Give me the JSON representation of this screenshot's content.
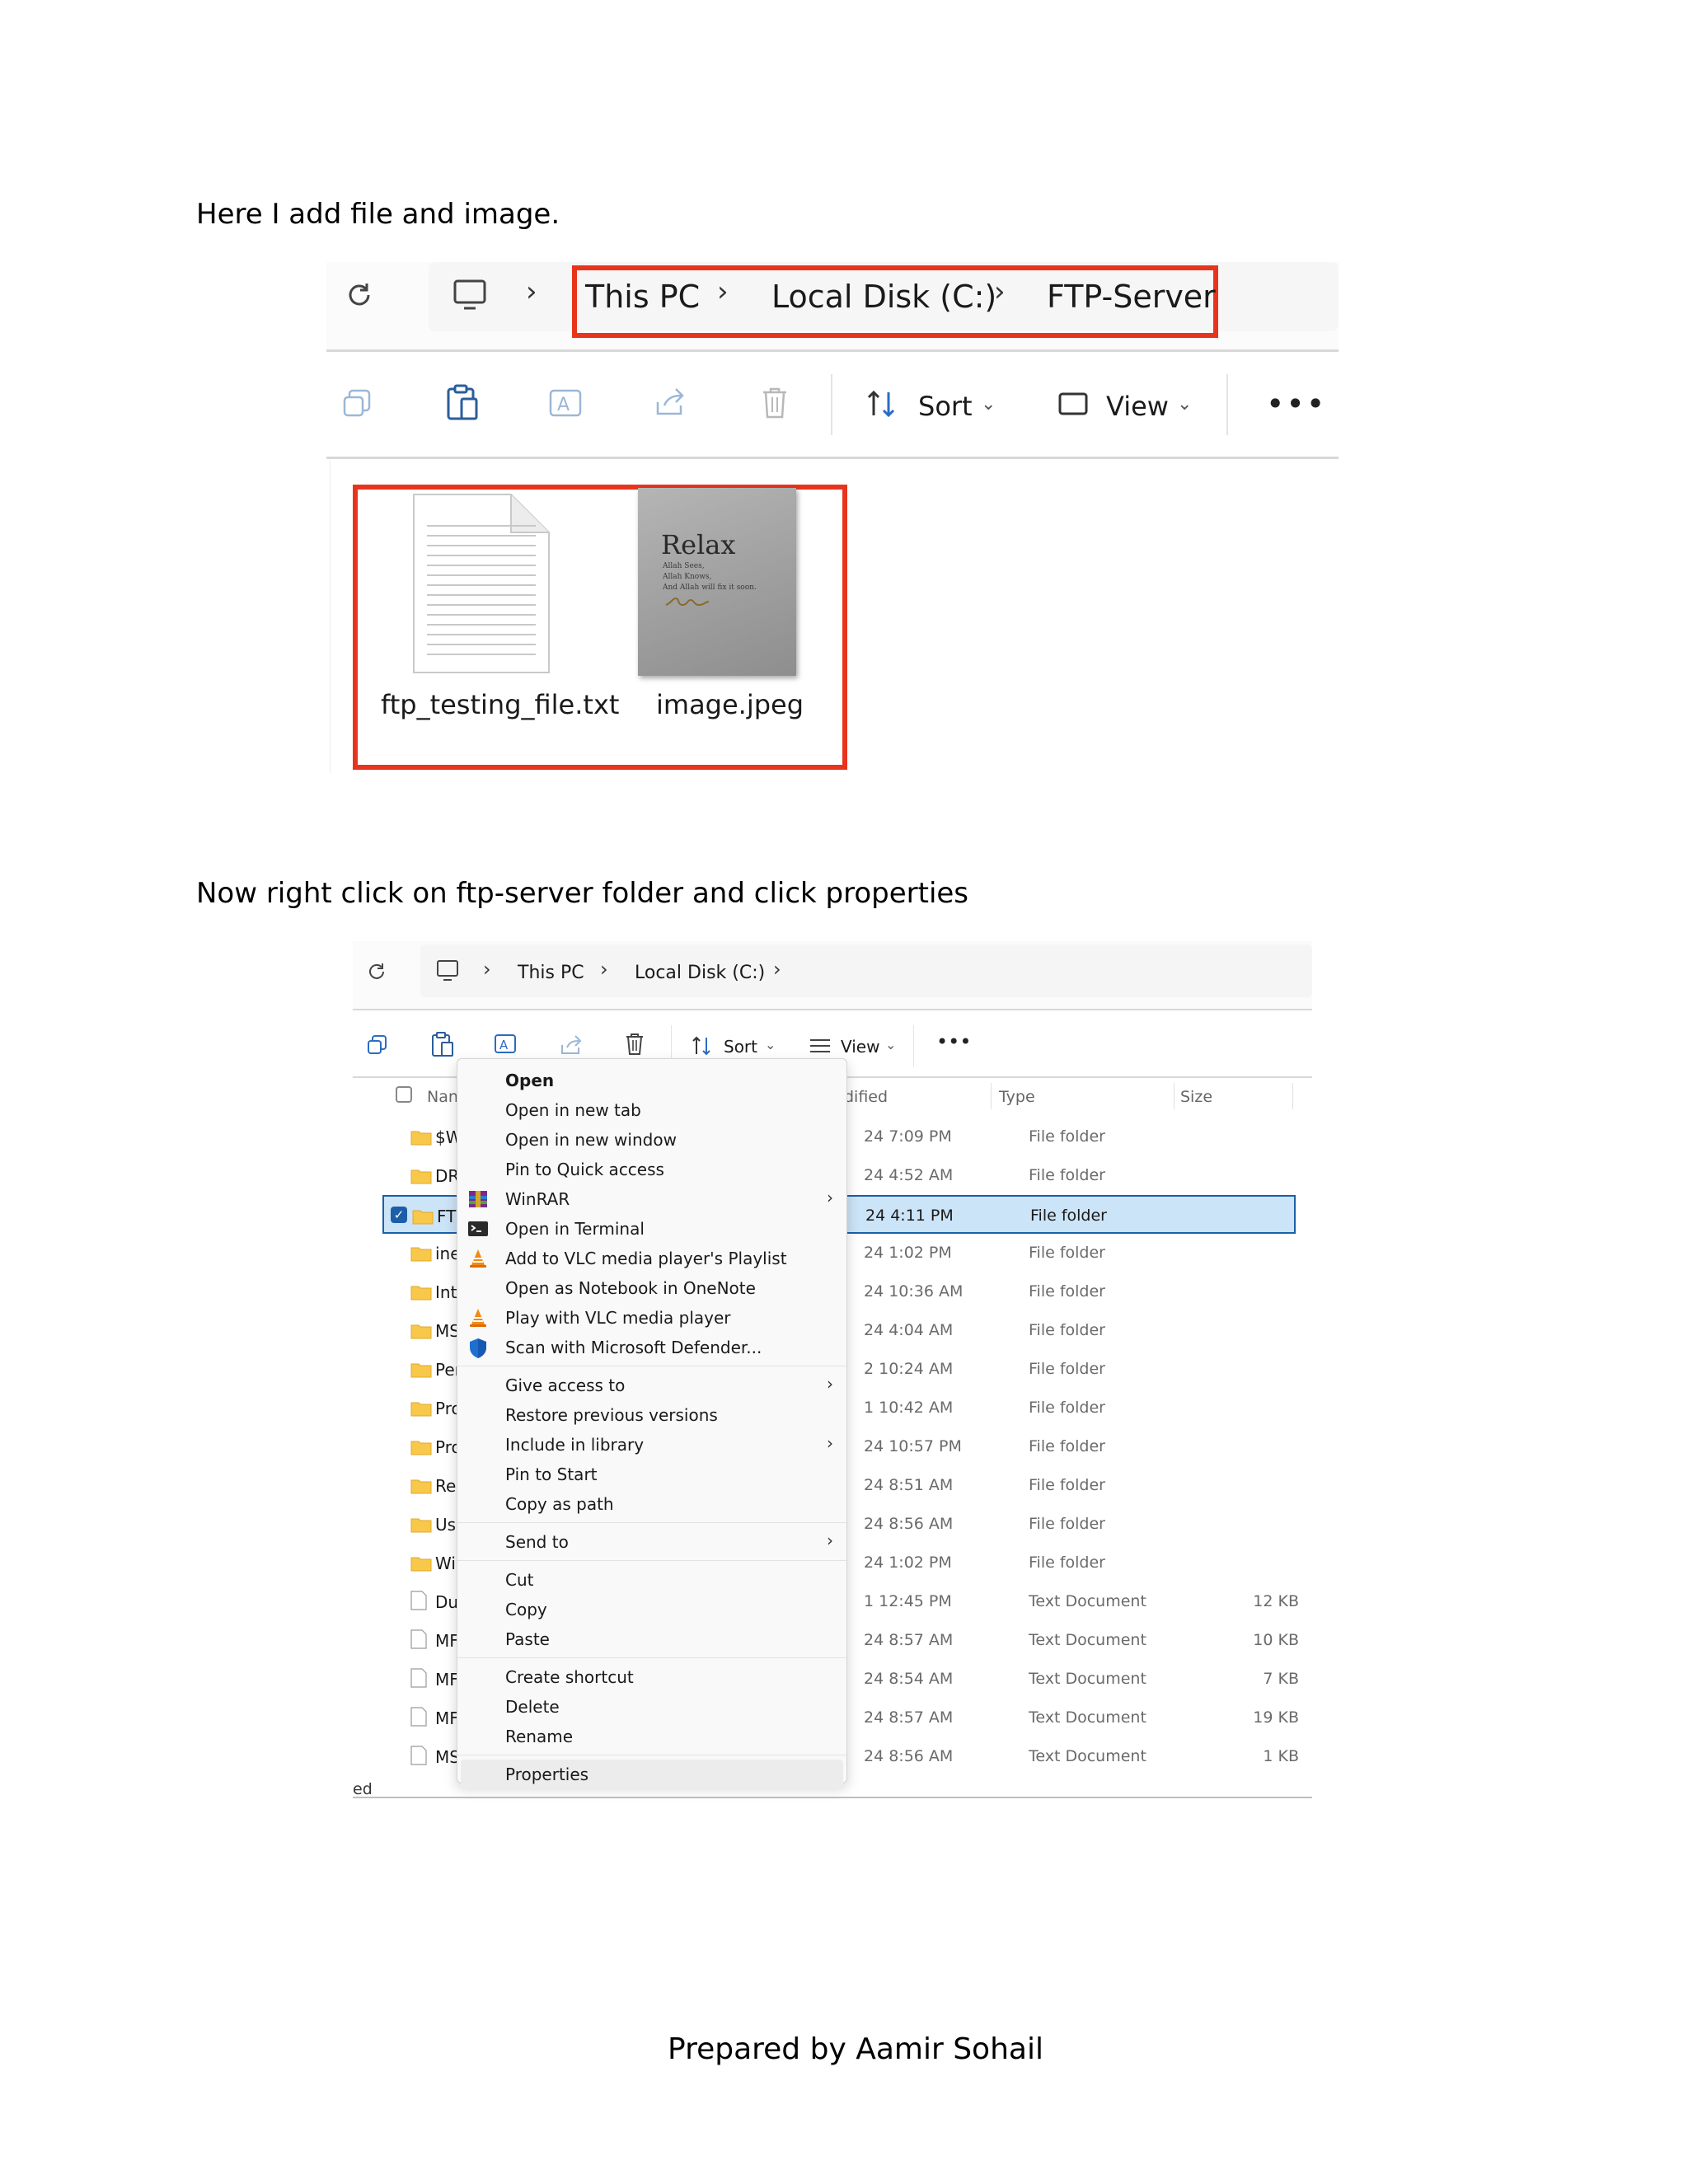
{
  "doc": {
    "caption1": "Here I add file and image.",
    "caption2": "Now right click on ftp-server folder and click properties",
    "footer": "Prepared by Aamir Sohail"
  },
  "shot1": {
    "breadcrumb": [
      "This PC",
      "Local Disk (C:)",
      "FTP-Server"
    ],
    "toolbar": {
      "sort_label": "Sort",
      "view_label": "View"
    },
    "files": [
      {
        "name": "ftp_testing_file.txt",
        "kind": "text-file"
      },
      {
        "name": "image.jpeg",
        "kind": "image",
        "thumb_title": "Relax",
        "thumb_lines": [
          "Allah Sees,",
          "Allah Knows,",
          "And Allah will fix it soon."
        ]
      }
    ],
    "highlight_color": "#e8341c"
  },
  "shot2": {
    "breadcrumb": [
      "This PC",
      "Local Disk (C:)"
    ],
    "toolbar": {
      "sort_label": "Sort",
      "view_label": "View"
    },
    "headers": {
      "name": "Nan",
      "date": "dified",
      "type": "Type",
      "size": "Size"
    },
    "rows": [
      {
        "name": "$W",
        "date": "24 7:09 PM",
        "type": "File folder",
        "size": "",
        "icon": "folder-icon"
      },
      {
        "name": "DR",
        "date": "24 4:52 AM",
        "type": "File folder",
        "size": "",
        "icon": "folder-icon"
      },
      {
        "name": "FTP",
        "date": "24 4:11 PM",
        "type": "File folder",
        "size": "",
        "icon": "folder-icon",
        "selected": true
      },
      {
        "name": "ine",
        "date": "24 1:02 PM",
        "type": "File folder",
        "size": "",
        "icon": "folder-icon"
      },
      {
        "name": "Inte",
        "date": "24 10:36 AM",
        "type": "File folder",
        "size": "",
        "icon": "folder-icon"
      },
      {
        "name": "MS",
        "date": "24 4:04 AM",
        "type": "File folder",
        "size": "",
        "icon": "folder-icon"
      },
      {
        "name": "Per",
        "date": "2 10:24 AM",
        "type": "File folder",
        "size": "",
        "icon": "folder-icon"
      },
      {
        "name": "Pro",
        "date": "1 10:42 AM",
        "type": "File folder",
        "size": "",
        "icon": "folder-icon"
      },
      {
        "name": "Pro",
        "date": "24 10:57 PM",
        "type": "File folder",
        "size": "",
        "icon": "folder-icon"
      },
      {
        "name": "Rec",
        "date": "24 8:51 AM",
        "type": "File folder",
        "size": "",
        "icon": "folder-icon"
      },
      {
        "name": "Use",
        "date": "24 8:56 AM",
        "type": "File folder",
        "size": "",
        "icon": "folder-icon"
      },
      {
        "name": "Wi",
        "date": "24 1:02 PM",
        "type": "File folder",
        "size": "",
        "icon": "folder-icon"
      },
      {
        "name": "Du",
        "date": "1 12:45 PM",
        "type": "Text Document",
        "size": "12 KB",
        "icon": "document-icon"
      },
      {
        "name": "MF",
        "date": "24 8:57 AM",
        "type": "Text Document",
        "size": "10 KB",
        "icon": "document-icon"
      },
      {
        "name": "MF",
        "date": "24 8:54 AM",
        "type": "Text Document",
        "size": "7 KB",
        "icon": "document-icon"
      },
      {
        "name": "MF",
        "date": "24 8:57 AM",
        "type": "Text Document",
        "size": "19 KB",
        "icon": "document-icon"
      },
      {
        "name": "MS",
        "date": "24 8:56 AM",
        "type": "Text Document",
        "size": "1 KB",
        "icon": "document-icon"
      }
    ],
    "status_fragment": "ed",
    "context_menu": {
      "group1": [
        {
          "label": "Open",
          "bold": true
        },
        {
          "label": "Open in new tab"
        },
        {
          "label": "Open in new window"
        },
        {
          "label": "Pin to Quick access"
        },
        {
          "label": "WinRAR",
          "icon": "winrar-icon",
          "submenu": true
        },
        {
          "label": "Open in Terminal",
          "icon": "terminal-icon"
        },
        {
          "label": "Add to VLC media player's Playlist",
          "icon": "vlc-icon"
        },
        {
          "label": "Open as Notebook in OneNote"
        },
        {
          "label": "Play with VLC media player",
          "icon": "vlc-icon"
        },
        {
          "label": "Scan with Microsoft Defender...",
          "icon": "defender-shield-icon"
        }
      ],
      "group2": [
        {
          "label": "Give access to",
          "submenu": true
        },
        {
          "label": "Restore previous versions"
        },
        {
          "label": "Include in library",
          "submenu": true
        },
        {
          "label": "Pin to Start"
        },
        {
          "label": "Copy as path"
        }
      ],
      "group3": [
        {
          "label": "Send to",
          "submenu": true
        }
      ],
      "group4": [
        {
          "label": "Cut"
        },
        {
          "label": "Copy"
        },
        {
          "label": "Paste"
        }
      ],
      "group5": [
        {
          "label": "Create shortcut"
        },
        {
          "label": "Delete"
        },
        {
          "label": "Rename"
        }
      ],
      "group6": [
        {
          "label": "Properties",
          "hover": true
        }
      ]
    }
  }
}
